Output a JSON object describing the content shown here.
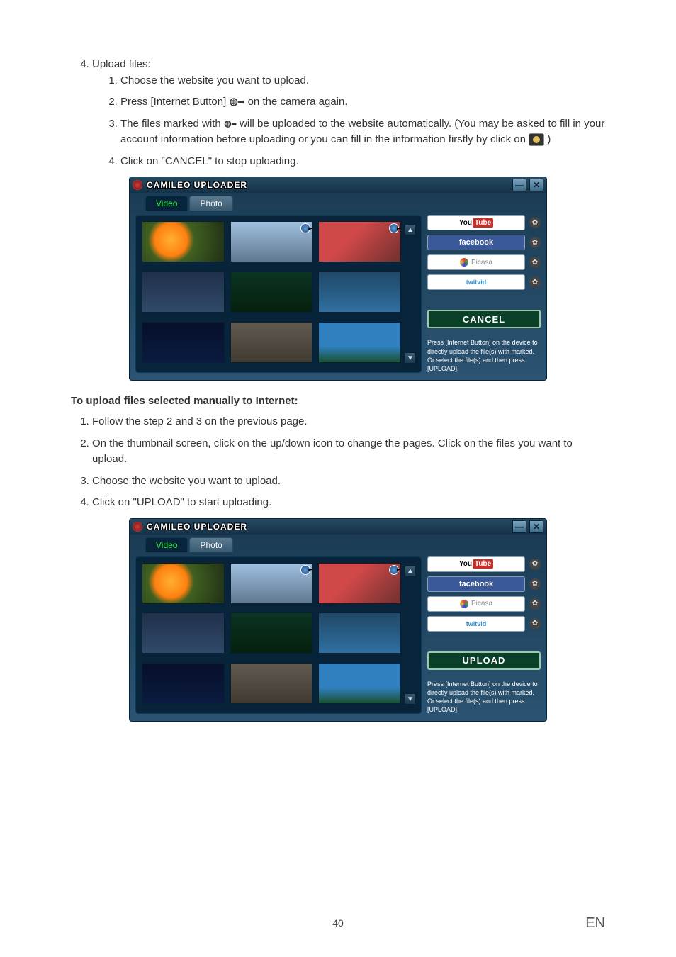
{
  "step4": {
    "number": "4.",
    "title": "Upload files:",
    "sub1": {
      "n": "1.",
      "text": "Choose the website you want to upload."
    },
    "sub2": {
      "n": "2.",
      "pre": "Press [Internet Button] ",
      "post": " on the camera again."
    },
    "sub3": {
      "n": "3.",
      "pre": "The files marked with ",
      "mid": " will be uploaded to the website automatically. (You may be asked to fill in your account information before uploading or you can fill in the information firstly by click on ",
      "post": " )"
    },
    "sub4": {
      "n": "4.",
      "text": "Click on \"CANCEL\" to stop uploading."
    }
  },
  "uploader_title": "CAMILEO UPLOADER",
  "tabs": {
    "video": "Video",
    "photo": "Photo"
  },
  "sites": {
    "youtube_you": "You",
    "youtube_tube": "Tube",
    "facebook": "facebook",
    "picasa": "Picasa",
    "twitvid": "twitvid"
  },
  "action": {
    "cancel": "CANCEL",
    "upload": "UPLOAD"
  },
  "hint": "Press [Internet Button] on the device to directly upload the file(s) with marked.\nOr select the file(s) and then press [UPLOAD].",
  "manual": {
    "heading": "To upload files selected manually to Internet:",
    "s1": {
      "n": "1.",
      "text": "Follow the step 2 and 3 on the previous page."
    },
    "s2": {
      "n": "2.",
      "text": "On the thumbnail screen, click on the up/down icon to change the pages. Click on the files you want to upload."
    },
    "s3": {
      "n": "3.",
      "text": "Choose the website you want to upload."
    },
    "s4": {
      "n": "4.",
      "text": "Click on \"UPLOAD\" to start uploading."
    }
  },
  "footer": {
    "page": "40",
    "lang": "EN"
  }
}
